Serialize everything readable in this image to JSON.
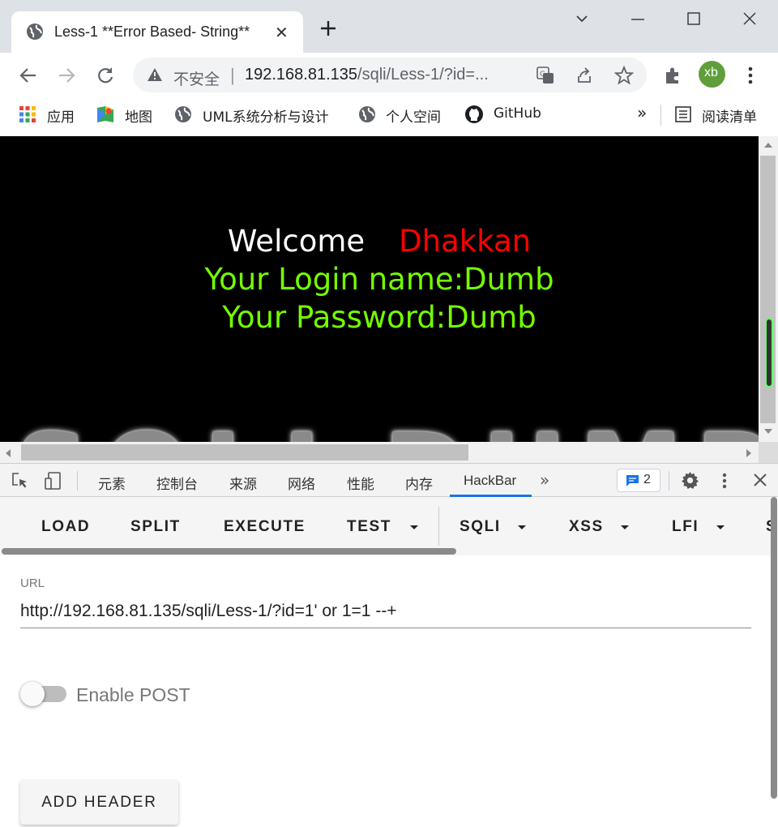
{
  "tab": {
    "title": "Less-1 **Error Based- String**"
  },
  "omnibox": {
    "security": "不安全",
    "host": "192.168.81.135",
    "path": "/sqli/Less-1/?id=..."
  },
  "profile": {
    "initials": "xb",
    "color": "#5f9e3a"
  },
  "bookmarks": {
    "apps": "应用",
    "maps": "地图",
    "uml": "UML系统分析与设计",
    "personal": "个人空间",
    "github": "GitHub",
    "reading_list": "阅读清单",
    "overflow": "»"
  },
  "page": {
    "welcome": "Welcome",
    "user": "Dhakkan",
    "login_line": "Your Login name:Dumb",
    "password_line": "Your Password:Dumb",
    "banner_text": "SQLI DUMB S",
    "colors": {
      "welcome": "#ffffff",
      "user": "#ff0000",
      "info": "#73ff00"
    }
  },
  "devtools": {
    "tabs": [
      "元素",
      "控制台",
      "来源",
      "网络",
      "性能",
      "内存",
      "HackBar"
    ],
    "active_tab": "HackBar",
    "messages_count": "2",
    "overflow": "»"
  },
  "hackbar": {
    "buttons": {
      "load": "LOAD",
      "split": "SPLIT",
      "execute": "EXECUTE",
      "test": "TEST",
      "sqli": "SQLI",
      "xss": "XSS",
      "lfi": "LFI",
      "more": "S"
    },
    "url_label": "URL",
    "url_value": "http://192.168.81.135/sqli/Less-1/?id=1' or 1=1 --+",
    "enable_post_label": "Enable POST",
    "enable_post": false,
    "add_header_label": "ADD HEADER",
    "accent_color": "#1a73e8"
  }
}
